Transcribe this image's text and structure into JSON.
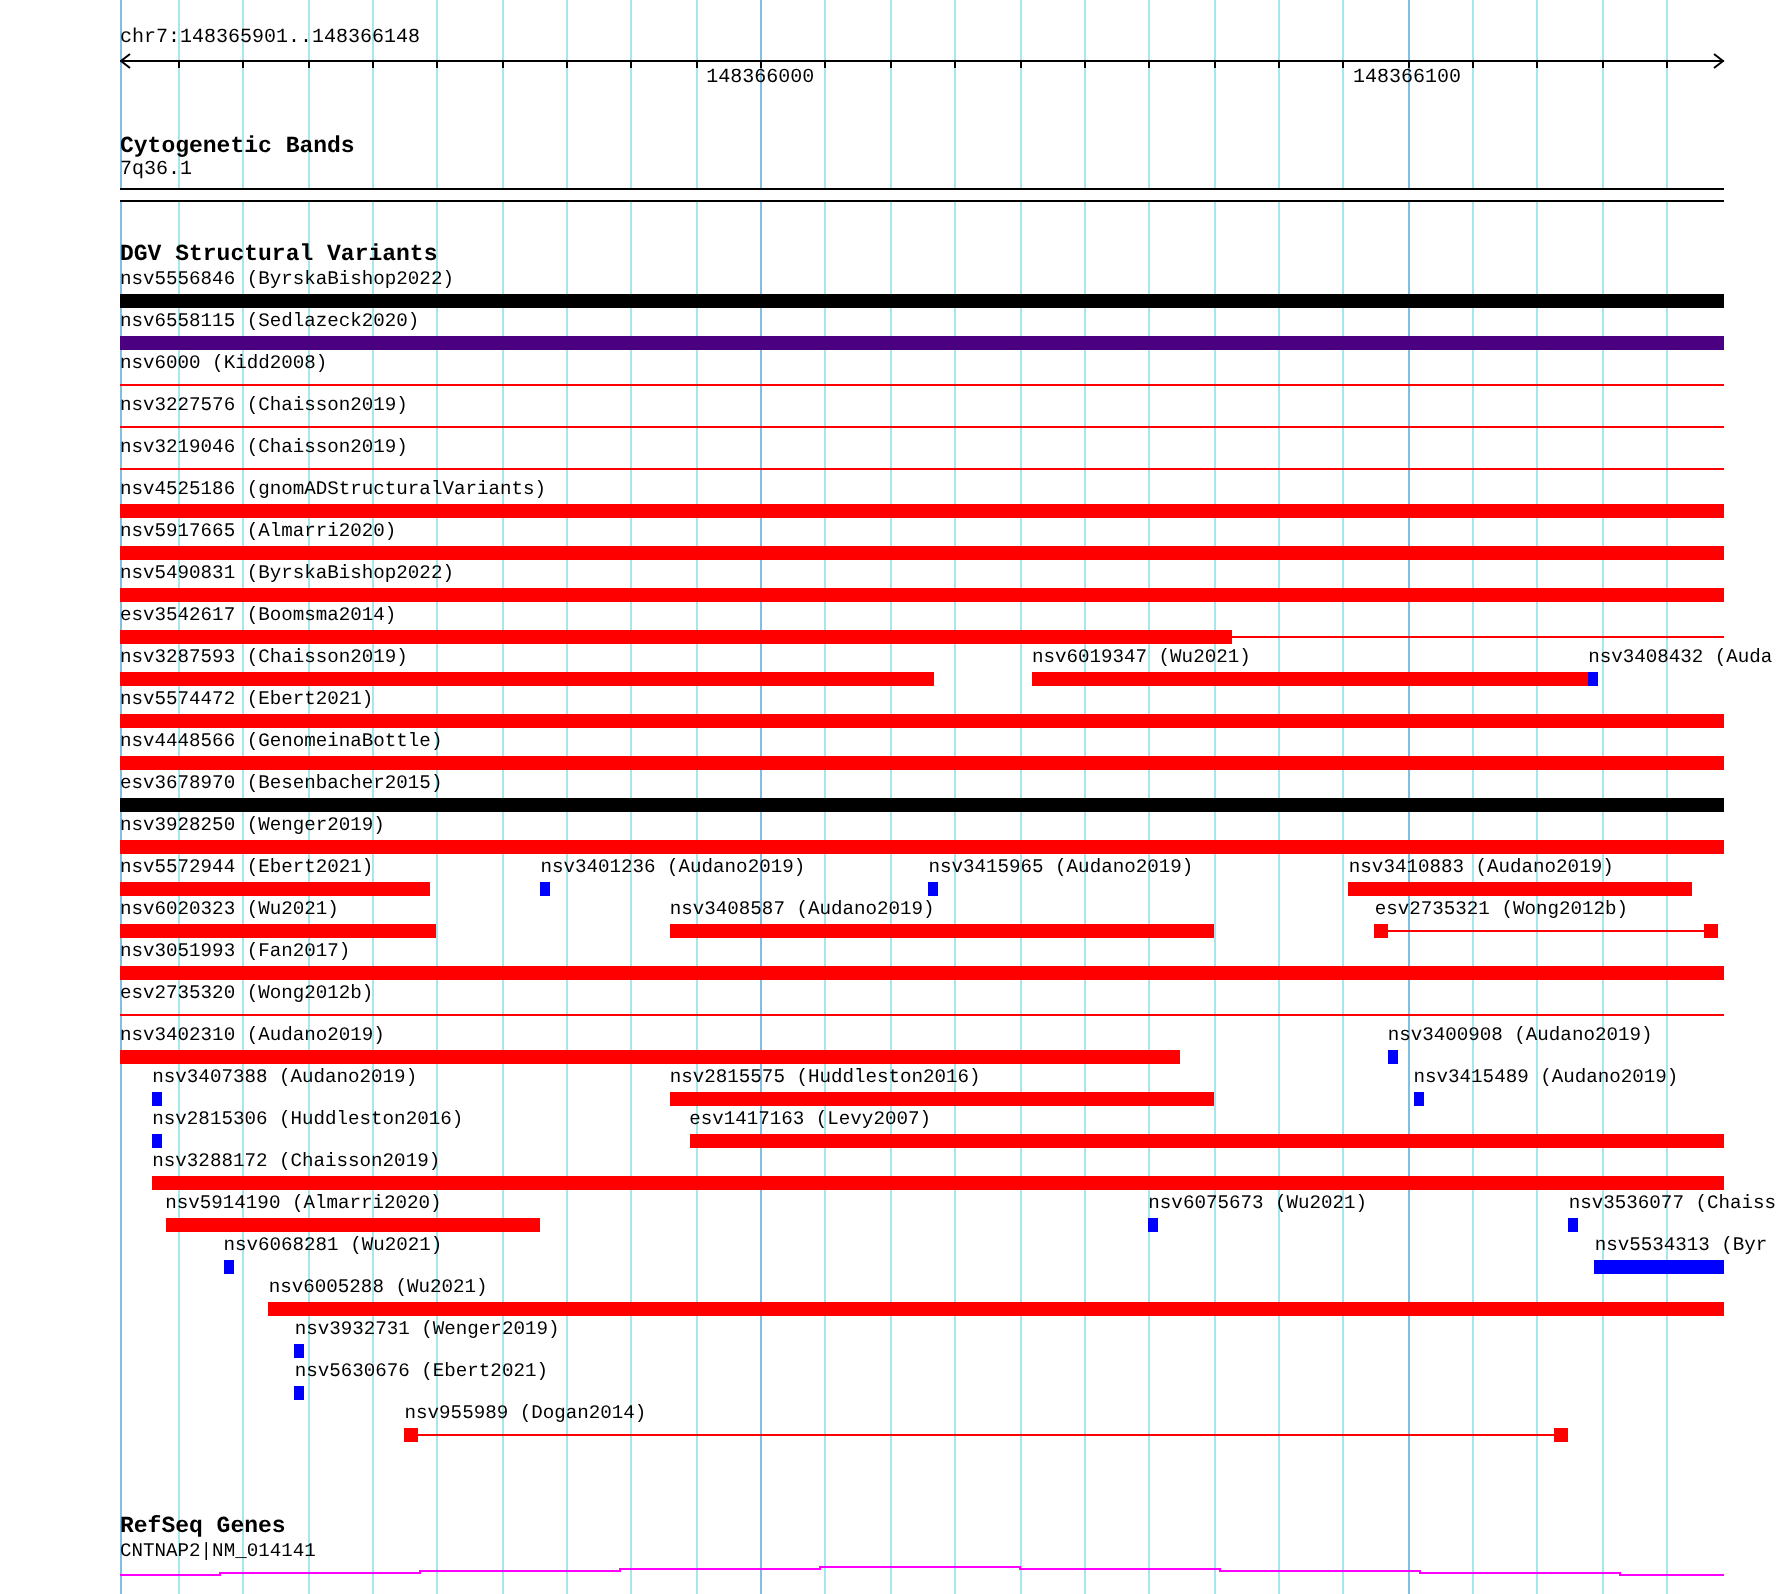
{
  "region": {
    "label": "chr7:148365901..148366148",
    "ticks": [
      "148366000",
      "148366100"
    ]
  },
  "cytogenetic_bands": {
    "title": "Cytogenetic Bands",
    "band": "7q36.1"
  },
  "dgv": {
    "title": "DGV Structural Variants",
    "rows": [
      {
        "features": [
          {
            "label": "nsv5556846 (ByrskaBishop2022)",
            "kind": "thick",
            "color": "#000000"
          }
        ]
      },
      {
        "features": [
          {
            "label": "nsv6558115 (Sedlazeck2020)",
            "kind": "thick",
            "color": "#4b0082"
          }
        ]
      },
      {
        "features": [
          {
            "label": "nsv6000 (Kidd2008)",
            "kind": "thin",
            "color": "#ff0000"
          }
        ]
      },
      {
        "features": [
          {
            "label": "nsv3227576 (Chaisson2019)",
            "kind": "thin",
            "color": "#ff0000"
          }
        ]
      },
      {
        "features": [
          {
            "label": "nsv3219046 (Chaisson2019)",
            "kind": "thin",
            "color": "#ff0000"
          }
        ]
      },
      {
        "features": [
          {
            "label": "nsv4525186 (gnomADStructuralVariants)",
            "kind": "thick",
            "color": "#ff0000"
          }
        ]
      },
      {
        "features": [
          {
            "label": "nsv5917665 (Almarri2020)",
            "kind": "thick",
            "color": "#ff0000"
          }
        ]
      },
      {
        "features": [
          {
            "label": "nsv5490831 (ByrskaBishop2022)",
            "kind": "thick",
            "color": "#ff0000"
          }
        ]
      },
      {
        "features": [
          {
            "label": "esv3542617 (Boomsma2014)",
            "kind": "thick_thin",
            "color": "#ff0000"
          }
        ]
      },
      {
        "features": [
          {
            "label": "nsv3287593 (Chaisson2019)",
            "kind": "thick",
            "color": "#ff0000"
          },
          {
            "label": "nsv6019347 (Wu2021)",
            "kind": "thick",
            "color": "#ff0000"
          },
          {
            "label": "nsv3408432 (Auda",
            "kind": "thick",
            "color": "#0000ff"
          }
        ]
      },
      {
        "features": [
          {
            "label": "nsv5574472 (Ebert2021)",
            "kind": "thick",
            "color": "#ff0000"
          }
        ]
      },
      {
        "features": [
          {
            "label": "nsv4448566 (GenomeinaBottle)",
            "kind": "thick",
            "color": "#ff0000"
          }
        ]
      },
      {
        "features": [
          {
            "label": "esv3678970 (Besenbacher2015)",
            "kind": "thick",
            "color": "#000000"
          }
        ]
      },
      {
        "features": [
          {
            "label": "nsv3928250 (Wenger2019)",
            "kind": "thick",
            "color": "#ff0000"
          }
        ]
      },
      {
        "features": [
          {
            "label": "nsv5572944 (Ebert2021)",
            "kind": "thick",
            "color": "#ff0000"
          },
          {
            "label": "nsv3401236 (Audano2019)",
            "kind": "thick",
            "color": "#0000ff"
          },
          {
            "label": "nsv3415965 (Audano2019)",
            "kind": "thick",
            "color": "#0000ff"
          },
          {
            "label": "nsv3410883 (Audano2019)",
            "kind": "thick",
            "color": "#ff0000"
          }
        ]
      },
      {
        "features": [
          {
            "label": "nsv6020323 (Wu2021)",
            "kind": "thick",
            "color": "#ff0000"
          },
          {
            "label": "nsv3408587 (Audano2019)",
            "kind": "thick",
            "color": "#ff0000"
          },
          {
            "label": "esv2735321 (Wong2012b)",
            "kind": "dumbbell",
            "color": "#ff0000"
          }
        ]
      },
      {
        "features": [
          {
            "label": "nsv3051993 (Fan2017)",
            "kind": "thick",
            "color": "#ff0000"
          }
        ]
      },
      {
        "features": [
          {
            "label": "esv2735320 (Wong2012b)",
            "kind": "thin",
            "color": "#ff0000"
          }
        ]
      },
      {
        "features": [
          {
            "label": "nsv3402310 (Audano2019)",
            "kind": "thick",
            "color": "#ff0000"
          },
          {
            "label": "nsv3400908 (Audano2019)",
            "kind": "thick",
            "color": "#0000ff"
          }
        ]
      },
      {
        "features": [
          {
            "label": "nsv3407388 (Audano2019)",
            "kind": "thick",
            "color": "#0000ff"
          },
          {
            "label": "nsv2815575 (Huddleston2016)",
            "kind": "thick",
            "color": "#ff0000"
          },
          {
            "label": "nsv3415489 (Audano2019)",
            "kind": "thick",
            "color": "#0000ff"
          }
        ]
      },
      {
        "features": [
          {
            "label": "nsv2815306 (Huddleston2016)",
            "kind": "thick",
            "color": "#0000ff"
          },
          {
            "label": "esv1417163 (Levy2007)",
            "kind": "thick",
            "color": "#ff0000"
          }
        ]
      },
      {
        "features": [
          {
            "label": "nsv3288172 (Chaisson2019)",
            "kind": "thick",
            "color": "#ff0000"
          }
        ]
      },
      {
        "features": [
          {
            "label": "nsv5914190 (Almarri2020)",
            "kind": "thick",
            "color": "#ff0000"
          },
          {
            "label": "nsv6075673 (Wu2021)",
            "kind": "thick",
            "color": "#0000ff"
          },
          {
            "label": "nsv3536077 (Chaiss",
            "kind": "thick",
            "color": "#0000ff"
          }
        ]
      },
      {
        "features": [
          {
            "label": "nsv6068281 (Wu2021)",
            "kind": "thick",
            "color": "#0000ff"
          },
          {
            "label": "nsv5534313 (Byr",
            "kind": "thick",
            "color": "#0000ff"
          }
        ]
      },
      {
        "features": [
          {
            "label": "nsv6005288 (Wu2021)",
            "kind": "thick",
            "color": "#ff0000"
          }
        ]
      },
      {
        "features": [
          {
            "label": "nsv3932731 (Wenger2019)",
            "kind": "thick",
            "color": "#0000ff"
          }
        ]
      },
      {
        "features": [
          {
            "label": "nsv5630676 (Ebert2021)",
            "kind": "thick",
            "color": "#0000ff"
          }
        ]
      },
      {
        "features": [
          {
            "label": "nsv955989 (Dogan2014)",
            "kind": "dumbbell",
            "color": "#ff0000"
          }
        ]
      }
    ]
  },
  "refseq": {
    "title": "RefSeq Genes",
    "gene": "CNTNAP2|NM_014141"
  }
}
